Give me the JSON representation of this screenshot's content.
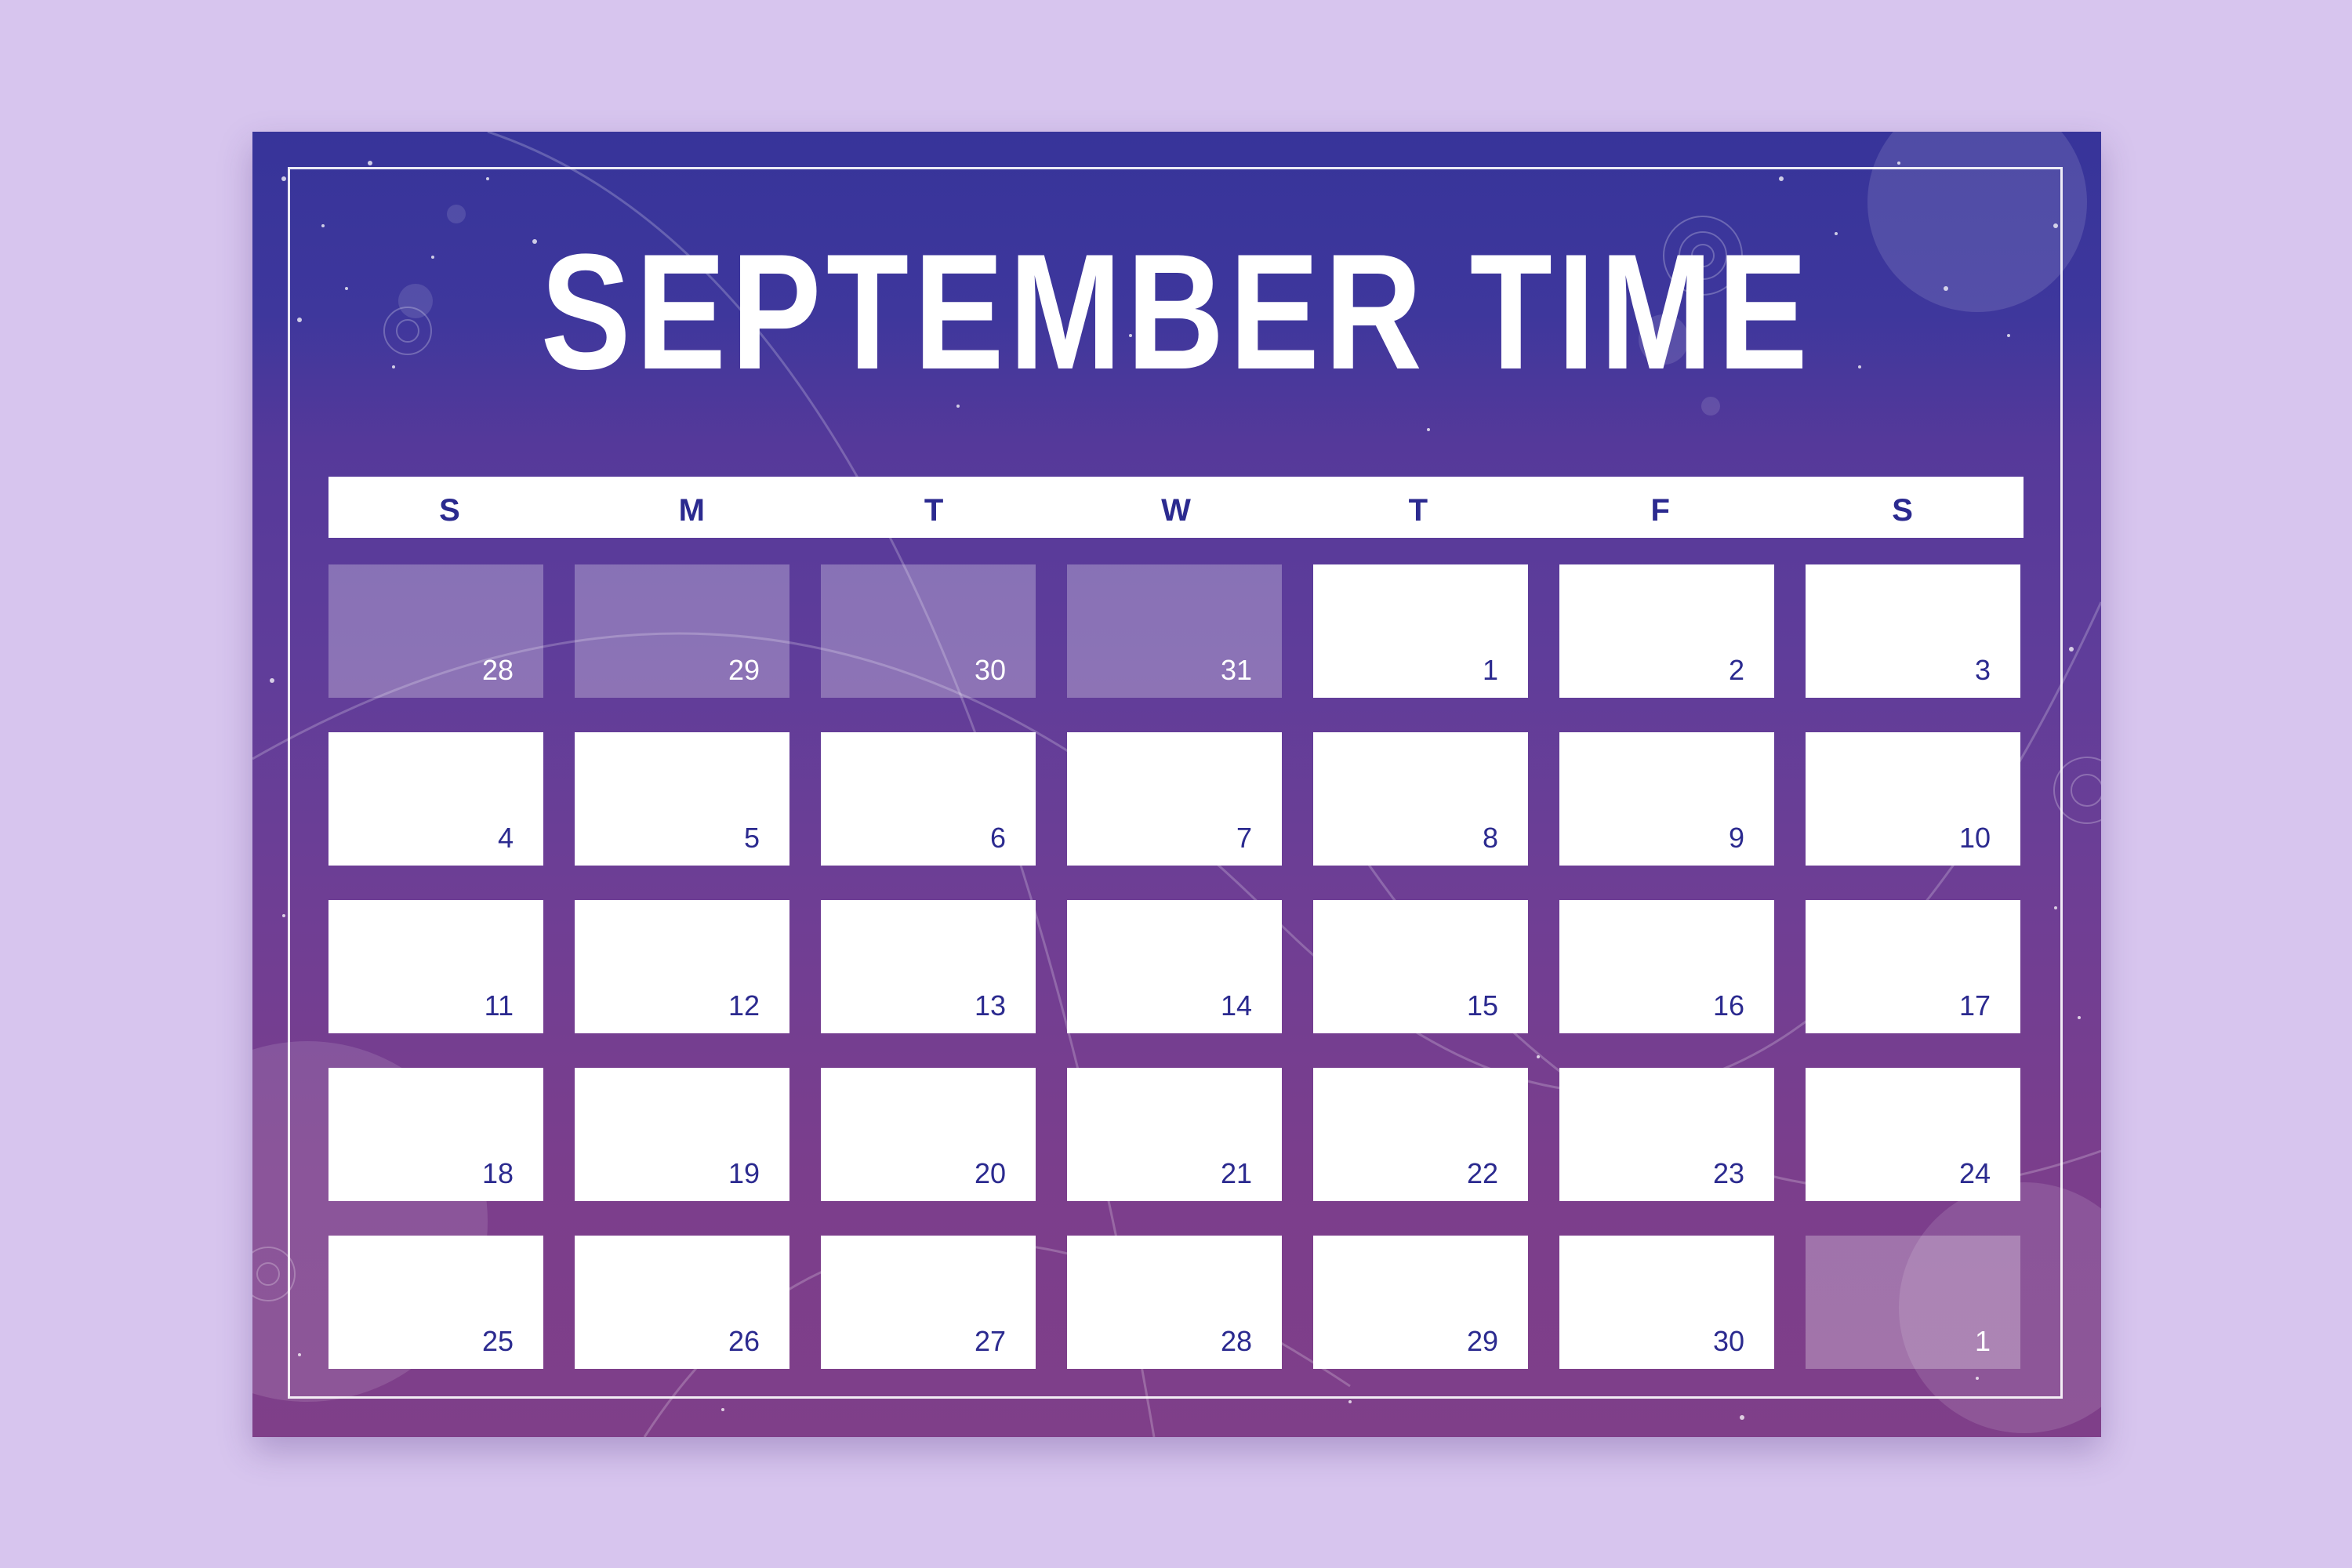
{
  "title": "SEPTEMBER TIME",
  "weekdays": [
    "S",
    "M",
    "T",
    "W",
    "T",
    "F",
    "S"
  ],
  "days": [
    {
      "label": "28",
      "faded": true
    },
    {
      "label": "29",
      "faded": true
    },
    {
      "label": "30",
      "faded": true
    },
    {
      "label": "31",
      "faded": true
    },
    {
      "label": "1",
      "faded": false
    },
    {
      "label": "2",
      "faded": false
    },
    {
      "label": "3",
      "faded": false
    },
    {
      "label": "4",
      "faded": false
    },
    {
      "label": "5",
      "faded": false
    },
    {
      "label": "6",
      "faded": false
    },
    {
      "label": "7",
      "faded": false
    },
    {
      "label": "8",
      "faded": false
    },
    {
      "label": "9",
      "faded": false
    },
    {
      "label": "10",
      "faded": false
    },
    {
      "label": "11",
      "faded": false
    },
    {
      "label": "12",
      "faded": false
    },
    {
      "label": "13",
      "faded": false
    },
    {
      "label": "14",
      "faded": false
    },
    {
      "label": "15",
      "faded": false
    },
    {
      "label": "16",
      "faded": false
    },
    {
      "label": "17",
      "faded": false
    },
    {
      "label": "18",
      "faded": false
    },
    {
      "label": "19",
      "faded": false
    },
    {
      "label": "20",
      "faded": false
    },
    {
      "label": "21",
      "faded": false
    },
    {
      "label": "22",
      "faded": false
    },
    {
      "label": "23",
      "faded": false
    },
    {
      "label": "24",
      "faded": false
    },
    {
      "label": "25",
      "faded": false
    },
    {
      "label": "26",
      "faded": false
    },
    {
      "label": "27",
      "faded": false
    },
    {
      "label": "28",
      "faded": false
    },
    {
      "label": "29",
      "faded": false
    },
    {
      "label": "30",
      "faded": false
    },
    {
      "label": "1",
      "faded": true
    }
  ],
  "colors": {
    "page_background": "#d7c5ee",
    "card_top": "#37349a",
    "card_bottom": "#7f3f89",
    "day_number": "#2b2a8f",
    "cell": "#ffffff"
  }
}
